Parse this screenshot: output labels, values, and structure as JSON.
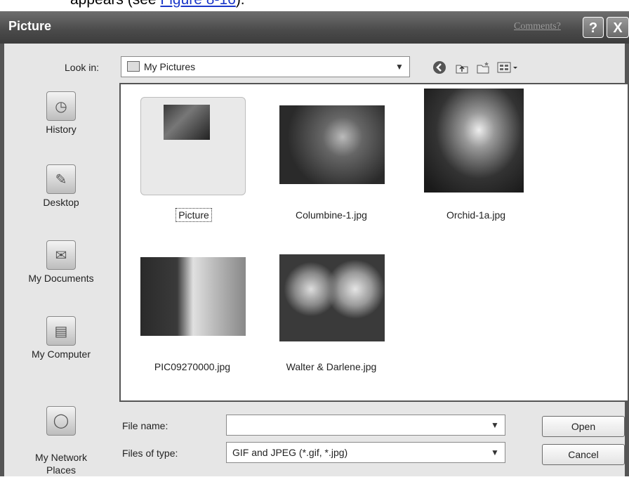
{
  "caption": {
    "prefix": "appears (see ",
    "link": "Figure 8-16",
    "suffix": ")."
  },
  "window": {
    "title": "Picture",
    "comments_link": "Comments?",
    "help_glyph": "?",
    "close_glyph": "X"
  },
  "lookin": {
    "label": "Look in:",
    "value": "My Pictures"
  },
  "places": [
    {
      "label": "History"
    },
    {
      "label": "Desktop"
    },
    {
      "label": "My Documents"
    },
    {
      "label": "My Computer"
    },
    {
      "label": "My Network\nPlaces"
    }
  ],
  "files": [
    {
      "name": "Picture"
    },
    {
      "name": "Columbine-1.jpg"
    },
    {
      "name": "Orchid-1a.jpg"
    },
    {
      "name": "PIC09270000.jpg"
    },
    {
      "name": "Walter & Darlene.jpg"
    }
  ],
  "filename": {
    "label": "File name:",
    "value": ""
  },
  "filetype": {
    "label": "Files of type:",
    "value": "GIF and JPEG (*.gif, *.jpg)"
  },
  "buttons": {
    "open": "Open",
    "cancel": "Cancel"
  }
}
